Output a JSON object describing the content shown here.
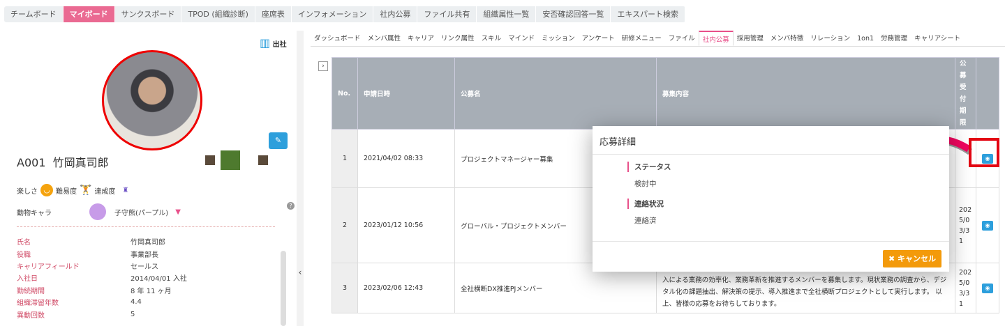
{
  "top_nav": [
    "チームボード",
    "マイボード",
    "サンクスボード",
    "TPOD (組織診断)",
    "座席表",
    "インフォメーション",
    "社内公募",
    "ファイル共有",
    "組織属性一覧",
    "安否確認回答一覧",
    "エキスパート検索"
  ],
  "top_nav_active": 1,
  "profile": {
    "status": "出社",
    "code": "A001",
    "name": "竹岡真司郎",
    "mood_labels": [
      "楽しさ",
      "難易度",
      "達成度"
    ],
    "animal_label": "動物キャラ",
    "animal_value": "子守熊(パープル)",
    "info": [
      [
        "氏名",
        "竹岡真司郎"
      ],
      [
        "役職",
        "事業部長"
      ],
      [
        "キャリアフィールド",
        "セールス"
      ],
      [
        "入社日",
        "2014/04/01 入社"
      ],
      [
        "勤続期間",
        "8 年 11 ヶ月"
      ],
      [
        "組織滞留年数",
        "4.4"
      ],
      [
        "異動回数",
        "5"
      ]
    ]
  },
  "sub_tabs": [
    "ダッシュボード",
    "メンバ属性",
    "キャリア",
    "リンク属性",
    "スキル",
    "マインド",
    "ミッション",
    "アンケート",
    "研修メニュー",
    "ファイル",
    "社内公募",
    "採用管理",
    "メンバ特徴",
    "リレーション",
    "1on1",
    "労務管理",
    "キャリアシート"
  ],
  "sub_tab_active": 10,
  "table": {
    "headers": [
      "No.",
      "申請日時",
      "公募名",
      "募集内容",
      "公募受付期限",
      ""
    ],
    "rows": [
      {
        "no": "1",
        "date": "2021/04/02 08:33",
        "title": "プロジェクトマネージャー募集",
        "content": "",
        "deadline": ""
      },
      {
        "no": "2",
        "date": "2023/01/12 10:56",
        "title": "グローバル・プロジェクトメンバー",
        "content": "",
        "deadline": "2025/03/31"
      },
      {
        "no": "3",
        "date": "2023/02/06 12:43",
        "title": "全社横断DX推進PJメンバー",
        "content": "入による業務の効率化、業務革新を推進するメンバーを募集します。現状業務の調査から、デジタル化の課題抽出、解決策の提示、導入推進まで全社横断プロジェクトとして実行します。 以上、皆様の応募をお待ちしております。",
        "deadline": "2025/03/31"
      }
    ]
  },
  "modal": {
    "title": "応募詳細",
    "status_label": "ステータス",
    "status_value": "検討中",
    "contact_label": "連絡状況",
    "contact_value": "連絡済",
    "cancel": "キャンセル"
  },
  "colors": {
    "accent": "#ea6a92",
    "button_blue": "#2d9fdc",
    "cancel": "#f39a0b",
    "highlight": "#e30613"
  }
}
